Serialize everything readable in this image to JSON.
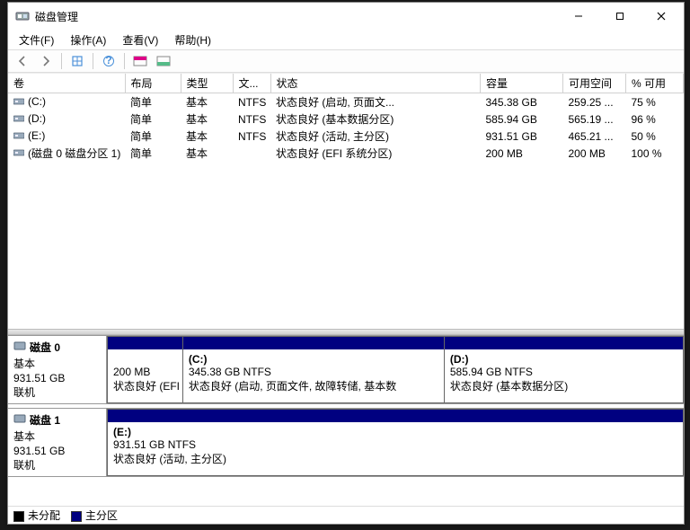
{
  "window": {
    "title": "磁盘管理"
  },
  "menu": {
    "file": "文件(F)",
    "action": "操作(A)",
    "view": "查看(V)",
    "help": "帮助(H)"
  },
  "columns": {
    "volume": "卷",
    "layout": "布局",
    "type": "类型",
    "fs": "文...",
    "status": "状态",
    "capacity": "容量",
    "free": "可用空间",
    "pct_free": "% 可用"
  },
  "volumes": [
    {
      "name": "(C:)",
      "layout": "简单",
      "type": "基本",
      "fs": "NTFS",
      "status": "状态良好 (启动, 页面文...",
      "capacity": "345.38 GB",
      "free": "259.25 ...",
      "pct": "75 %"
    },
    {
      "name": "(D:)",
      "layout": "简单",
      "type": "基本",
      "fs": "NTFS",
      "status": "状态良好 (基本数据分区)",
      "capacity": "585.94 GB",
      "free": "565.19 ...",
      "pct": "96 %"
    },
    {
      "name": "(E:)",
      "layout": "简单",
      "type": "基本",
      "fs": "NTFS",
      "status": "状态良好 (活动, 主分区)",
      "capacity": "931.51 GB",
      "free": "465.21 ...",
      "pct": "50 %"
    },
    {
      "name": "(磁盘 0 磁盘分区 1)",
      "layout": "简单",
      "type": "基本",
      "fs": "",
      "status": "状态良好 (EFI 系统分区)",
      "capacity": "200 MB",
      "free": "200 MB",
      "pct": "100 %"
    }
  ],
  "disks": [
    {
      "label": "磁盘 0",
      "kind": "基本",
      "size": "931.51 GB",
      "state": "联机",
      "parts": [
        {
          "title": "",
          "line2": "200 MB",
          "line3": "状态良好 (EFI 系",
          "flex": 1
        },
        {
          "title": "(C:)",
          "line2": "345.38 GB NTFS",
          "line3": "状态良好 (启动, 页面文件, 故障转储, 基本数",
          "flex": 3.5
        },
        {
          "title": "(D:)",
          "line2": "585.94 GB NTFS",
          "line3": "状态良好 (基本数据分区)",
          "flex": 3.2
        }
      ]
    },
    {
      "label": "磁盘 1",
      "kind": "基本",
      "size": "931.51 GB",
      "state": "联机",
      "parts": [
        {
          "title": "(E:)",
          "line2": "931.51 GB NTFS",
          "line3": "状态良好 (活动, 主分区)",
          "flex": 1
        }
      ]
    }
  ],
  "legend": {
    "unallocated": "未分配",
    "primary": "主分区"
  }
}
